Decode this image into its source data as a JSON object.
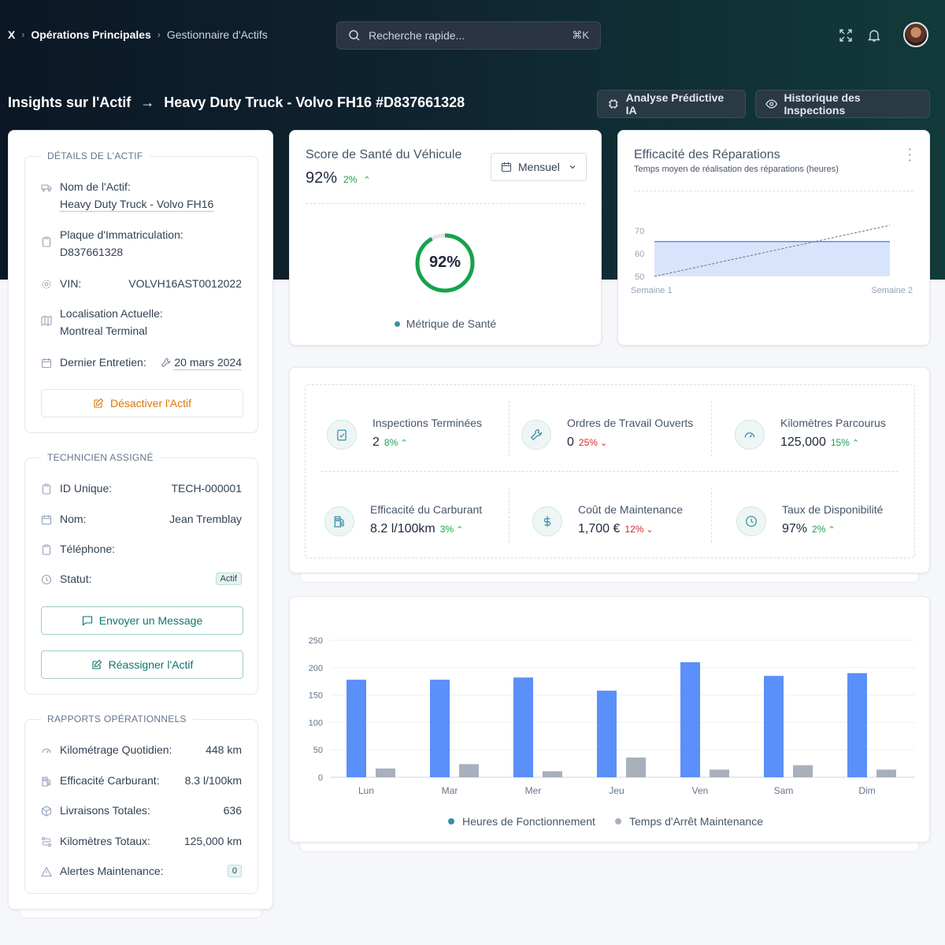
{
  "breadcrumbs": {
    "root": "X",
    "level1": "Opérations Principales",
    "level2": "Gestionnaire d'Actifs"
  },
  "search": {
    "placeholder": "Recherche rapide...",
    "shortcut": "⌘K"
  },
  "topbar_icons": [
    "fullscreen-icon",
    "bell-icon"
  ],
  "page": {
    "title_prefix": "Insights sur l'Actif",
    "title_asset": "Heavy Duty Truck - Volvo FH16 #D837661328"
  },
  "header_buttons": {
    "ai": "Analyse Prédictive IA",
    "history": "Historique des Inspections"
  },
  "asset_details": {
    "section_title": "DÉTAILS DE L'ACTIF",
    "name_label": "Nom de l'Actif:",
    "name_value": "Heavy Duty Truck - Volvo FH16",
    "plate_label": "Plaque d'Immatriculation:",
    "plate_value": "D837661328",
    "vin_label": "VIN:",
    "vin_value": "VOLVH16AST0012022",
    "location_label": "Localisation Actuelle:",
    "location_value": "Montreal Terminal",
    "maintenance_label": "Dernier Entretien:",
    "maintenance_value": "20 mars 2024",
    "deactivate": "Désactiver l'Actif"
  },
  "technician": {
    "section_title": "TECHNICIEN ASSIGNÉ",
    "id_label": "ID Unique:",
    "id_value": "TECH-000001",
    "name_label": "Nom:",
    "name_value": "Jean Tremblay",
    "phone_label": "Téléphone:",
    "status_label": "Statut:",
    "status_value": "Actif",
    "message": "Envoyer un Message",
    "reassign": "Réassigner l'Actif"
  },
  "reports": {
    "section_title": "RAPPORTS OPÉRATIONNELS",
    "daily_label": "Kilométrage Quotidien:",
    "daily_value": "448 km",
    "fuel_label": "Efficacité Carburant:",
    "fuel_value": "8.3 l/100km",
    "deliveries_label": "Livraisons Totales:",
    "deliveries_value": "636",
    "total_label": "Kilomètres Totaux:",
    "total_value": "125,000 km",
    "alerts_label": "Alertes Maintenance:",
    "alerts_value": "0"
  },
  "health": {
    "title": "Score de Santé du Véhicule",
    "value": "92%",
    "delta": "2%",
    "period": "Mensuel",
    "gauge_label": "92%",
    "gauge_fraction": 0.92,
    "legend": "Métrique de Santé"
  },
  "repairs": {
    "title": "Efficacité des Réparations",
    "subtitle": "Temps moyen de réalisation des réparations (heures)",
    "yticks": [
      "70",
      "60",
      "50"
    ],
    "xticks": [
      "Semaine 1",
      "Semaine 2"
    ],
    "area_values": [
      65,
      65
    ],
    "trend_values": [
      50,
      72
    ],
    "ylim": [
      50,
      72
    ]
  },
  "kpis": [
    {
      "label": "Inspections Terminées",
      "value": "2",
      "delta": "8%",
      "dir": "up",
      "icon": "clipboard-icon"
    },
    {
      "label": "Ordres de Travail Ouverts",
      "value": "0",
      "delta": "25%",
      "dir": "down",
      "icon": "wrench-icon"
    },
    {
      "label": "Kilomètres Parcourus",
      "value": "125,000",
      "delta": "15%",
      "dir": "up",
      "icon": "gauge-icon"
    },
    {
      "label": "Efficacité du Carburant",
      "value": "8.2 l/100km",
      "delta": "3%",
      "dir": "up",
      "icon": "fuel-icon"
    },
    {
      "label": "Coût de Maintenance",
      "value": "1,700 €",
      "delta": "12%",
      "dir": "down",
      "icon": "dollar-icon"
    },
    {
      "label": "Taux de Disponibilité",
      "value": "97%",
      "delta": "2%",
      "dir": "up",
      "icon": "clock-icon"
    }
  ],
  "chart_data": {
    "type": "bar",
    "categories": [
      "Lun",
      "Mar",
      "Mer",
      "Jeu",
      "Ven",
      "Sam",
      "Dim"
    ],
    "series": [
      {
        "name": "Heures de Fonctionnement",
        "values": [
          178,
          178,
          182,
          158,
          210,
          185,
          190
        ],
        "color": "#5b8ff9"
      },
      {
        "name": "Temps d'Arrêt Maintenance",
        "values": [
          16,
          24,
          11,
          36,
          14,
          22,
          14
        ],
        "color": "#a8b0bd"
      }
    ],
    "yticks": [
      0,
      50,
      100,
      150,
      200,
      250
    ],
    "ylim": [
      0,
      250
    ],
    "grid": true,
    "legend": "bottom"
  }
}
